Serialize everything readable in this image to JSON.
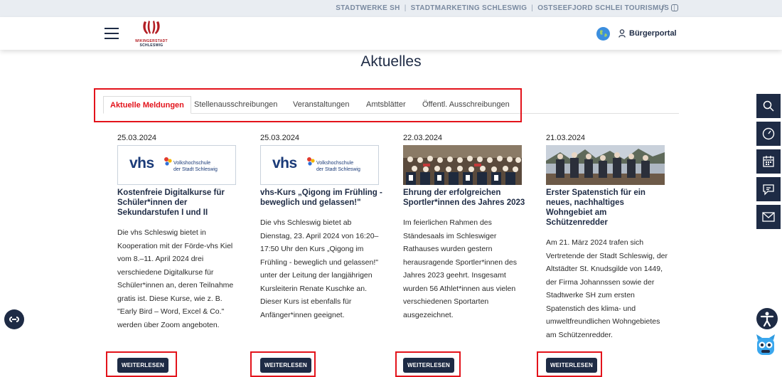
{
  "topbar": {
    "links": [
      "STADTWERKE SH",
      "STADTMARKETING SCHLESWIG",
      "OSTSEEFJORD SCHLEI TOURISMUS"
    ],
    "separator": "|"
  },
  "header": {
    "logo_line1": "WIKINGERSTADT",
    "logo_line2": "SCHLESWIG",
    "portal_label": "Bürgerportal"
  },
  "page": {
    "title": "Aktuelles"
  },
  "tabs": [
    {
      "label": "Aktuelle Meldungen",
      "active": true
    },
    {
      "label": "Stellenausschreibungen"
    },
    {
      "label": "Veranstaltungen"
    },
    {
      "label": "Amtsblätter"
    },
    {
      "label": "Öffentl. Ausschreibungen"
    }
  ],
  "vhs_logo": {
    "brand": "vhs",
    "line1": "Volkshochschule",
    "line2": "der Stadt Schleswig"
  },
  "cards": [
    {
      "date": "25.03.2024",
      "title": "Kostenfreie Digitalkurse für Schüler*innen der Sekundarstufen I und II",
      "text": "Die vhs Schleswig bietet in Kooperation mit der Förde-vhs Kiel vom 8.–11. April 2024 drei verschiedene Digitalkurse für Schüler*innen an, deren Teilnahme gratis ist. Diese Kurse, wie z. B. \"Early Bird – Word, Excel & Co.\" werden über Zoom angeboten.",
      "button": "WEITERLESEN"
    },
    {
      "date": "25.03.2024",
      "title": "vhs-Kurs „Qigong im Frühling - beweglich und gelassen!\"",
      "text": "Die vhs Schleswig bietet ab Dienstag, 23. April 2024 von 16:20–17:50 Uhr den Kurs „Qigong im Frühling - beweglich und gelassen!\" unter der Leitung der langjährigen Kursleiterin Renate Kuschke an. Dieser Kurs ist ebenfalls für Anfänger*innen geeignet.",
      "button": "WEITERLESEN"
    },
    {
      "date": "22.03.2024",
      "title": "Ehrung der erfolgreichen Sportler*innen des Jahres 2023",
      "text": "Im feierlichen Rahmen des Ständesaals im Schleswiger Rathauses wurden gestern herausragende Sportler*innen des Jahres 2023 geehrt. Insgesamt wurden 56 Athlet*innen aus vielen verschiedenen Sportarten ausgezeichnet.",
      "button": "WEITERLESEN"
    },
    {
      "date": "21.03.2024",
      "title": "Erster Spatenstich für ein neues, nachhaltiges Wohngebiet am Schützenredder",
      "text": "Am 21. März 2024 trafen sich Vertretende der Stadt Schleswig, der Altstädter St. Knudsgilde von 1449, der Firma Johannssen sowie der Stadtwerke SH zum ersten Spatenstich des klima- und umweltfreundlichen Wohngebietes am Schützenredder.",
      "button": "WEITERLESEN"
    }
  ]
}
